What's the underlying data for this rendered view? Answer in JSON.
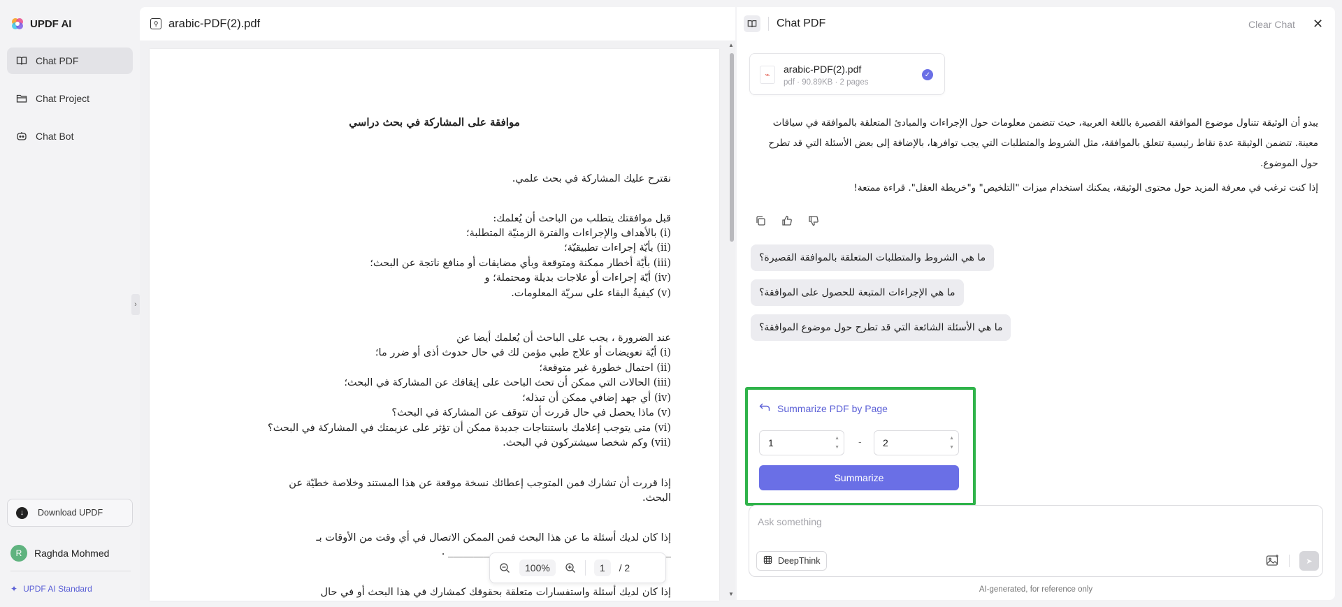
{
  "sidebar": {
    "brand": "UPDF AI",
    "items": [
      {
        "label": "Chat PDF",
        "icon": "book-open-icon",
        "active": true
      },
      {
        "label": "Chat Project",
        "icon": "folder-icon",
        "active": false
      },
      {
        "label": "Chat Bot",
        "icon": "bot-icon",
        "active": false
      }
    ],
    "download_label": "Download UPDF",
    "user": {
      "initial": "R",
      "name": "Raghda Mohmed"
    },
    "plan": "UPDF AI Standard"
  },
  "viewer": {
    "filename": "arabic-PDF(2).pdf",
    "doc_title": "موافقة على المشاركة في بحث دراسي",
    "lines": [
      "نقترح عليك المشاركة في بحث علمي.",
      "قبل موافقتك يتطلب من الباحث أن يُعلمك:",
      "(i) بالأهداف والإجراءات والفترة الزمنيّة المتطلبة؛",
      "(ii) بأيّة إجراءات تطبيقيّة؛",
      "(iii) بأيّة أخطار ممكنة ومتوقعة وبأي مضايقات أو منافع ناتجة عن البحث؛",
      "(iv) أيّة إجراءات أو علاجات بديلة ومحتملة؛ و",
      "(v) كيفيةُ البقاء على سريّة المعلومات.",
      "عند الضرورة ، يجب على الباحث أن يُعلمك أيضا عن",
      "(i) أيّة تعويضات أو علاج طبي مؤمن لك في حال حدوث أذى أو ضرر ما؛",
      "(ii) احتمال خطورة غير متوقعة؛",
      "(iii) الحالات التي ممكن أن تحث الباحث على إيقافك عن المشاركة في البحث؛",
      "(iv) أي جهد إضافي ممكن أن تبذله؛",
      "(v) ماذا يحصل في حال قررت أن تتوقف عن المشاركة في البحث؟",
      "(vi) متى يتوجب إعلامك باستنتاجات جديدة ممكن أن تؤثر على عزيمتك في المشاركة في البحث؟",
      "(vii) وكم شخصا سيشتركون في البحث.",
      "إذا قررت أن تشارك فمن المتوجب إعطائك نسخة موقعة عن هذا المستند وخلاصة خطيّة عن",
      "البحث.",
      "إذا كان لديك أسئلة ما عن هذا البحث فمن الممكن الاتصال في أي وقت من الأوقات بـ",
      "____________________________________________ .",
      "إذا كان لديك أسئلة واستفسارات متعلقة بحقوقك كمشارك في هذا البحث أو في حال"
    ],
    "zoom": "100%",
    "page_current": "1",
    "page_total": "/ 2"
  },
  "chat": {
    "title": "Chat PDF",
    "clear_label": "Clear Chat",
    "file": {
      "name": "arabic-PDF(2).pdf",
      "meta": "pdf · 90.89KB · 2 pages"
    },
    "answer_p1": "يبدو أن الوثيقة تتناول موضوع الموافقة القصيرة باللغة العربية، حيث تتضمن معلومات حول الإجراءات والمبادئ المتعلقة بالموافقة في سياقات معينة. تتضمن الوثيقة عدة نقاط رئيسية تتعلق بالموافقة، مثل الشروط والمتطلبات التي يجب توافرها، بالإضافة إلى بعض الأسئلة التي قد تطرح حول الموضوع.",
    "answer_p2": "إذا كنت ترغب في معرفة المزيد حول محتوى الوثيقة، يمكنك استخدام ميزات \"التلخيص\" و\"خريطة العقل\". قراءة ممتعة!",
    "suggestions": [
      "ما هي الشروط والمتطلبات المتعلقة بالموافقة القصيرة؟",
      "ما هي الإجراءات المتبعة للحصول على الموافقة؟",
      "ما هي الأسئلة الشائعة التي قد تطرح حول موضوع الموافقة؟"
    ],
    "summarize": {
      "title": "Summarize PDF by Page",
      "from": "1",
      "to": "2",
      "dash": "-",
      "button": "Summarize"
    },
    "ask_placeholder": "Ask something",
    "deepthink_label": "DeepThink",
    "disclaimer": "AI-generated, for reference only"
  },
  "colors": {
    "accent": "#6a6fe6",
    "highlight_border": "#2fb34a"
  }
}
